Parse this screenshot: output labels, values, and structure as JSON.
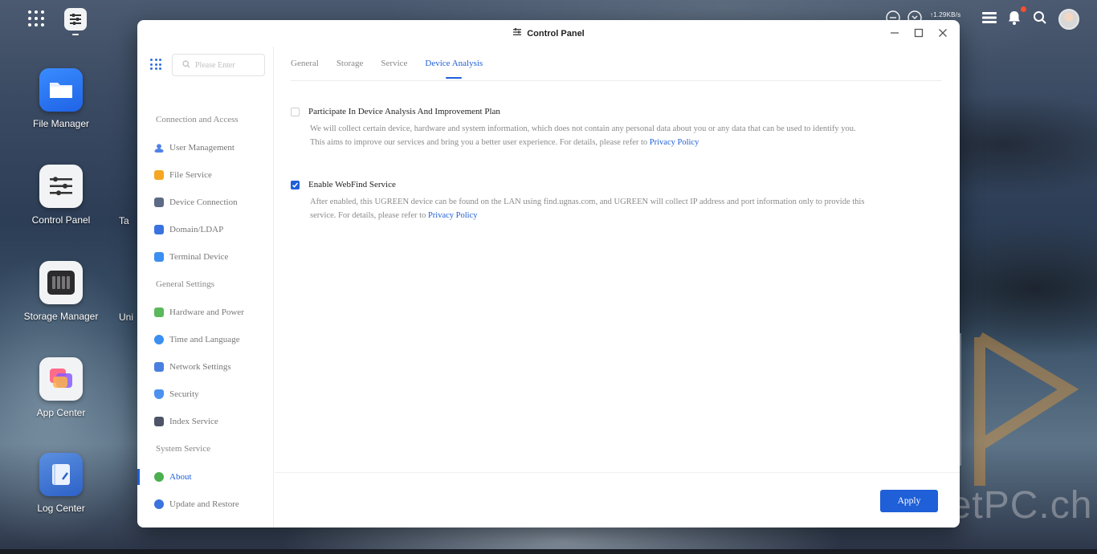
{
  "topbar": {
    "network_speed": "↑1.29KB/s"
  },
  "desktop": {
    "icons": [
      {
        "label": "File Manager"
      },
      {
        "label": "Control Panel"
      },
      {
        "label": "Storage Manager"
      },
      {
        "label": "App Center"
      },
      {
        "label": "Log Center"
      }
    ],
    "partial_icons": [
      {
        "label": "Ta"
      },
      {
        "label": "Uni"
      }
    ]
  },
  "window": {
    "title": "Control Panel"
  },
  "sidebar": {
    "search_placeholder": "Please Enter",
    "sections": [
      {
        "title": "Connection and Access",
        "items": [
          "User Management",
          "File Service",
          "Device Connection",
          "Domain/LDAP",
          "Terminal Device"
        ]
      },
      {
        "title": "General Settings",
        "items": [
          "Hardware and Power",
          "Time and Language",
          "Network Settings",
          "Security",
          "Index Service"
        ]
      },
      {
        "title": "System Service",
        "items": [
          "About",
          "Update and Restore"
        ]
      }
    ],
    "active_item": "About"
  },
  "tabs": [
    "General",
    "Storage",
    "Service",
    "Device Analysis"
  ],
  "active_tab": "Device Analysis",
  "options": {
    "analysis": {
      "title": "Participate In Device Analysis And Improvement Plan",
      "checked": false,
      "desc_line1": "We will collect certain device, hardware and system information, which does not contain any personal data about you or any data that can be used to identify you.",
      "desc_line2": "This aims to improve our services and bring you a better user experience. For details, please refer to",
      "link": "Privacy Policy"
    },
    "webfind": {
      "title": "Enable WebFind Service",
      "checked": true,
      "desc_line1": "After enabled, this UGREEN device can be found on the LAN using find.ugnas.com, and UGREEN will collect IP address and port information only to provide this",
      "desc_line2": "service. For details, please refer to",
      "link": "Privacy Policy"
    }
  },
  "footer": {
    "apply_label": "Apply"
  },
  "watermark": {
    "text": "PocketPC.ch"
  },
  "colors": {
    "accent": "#1f5fd8"
  }
}
